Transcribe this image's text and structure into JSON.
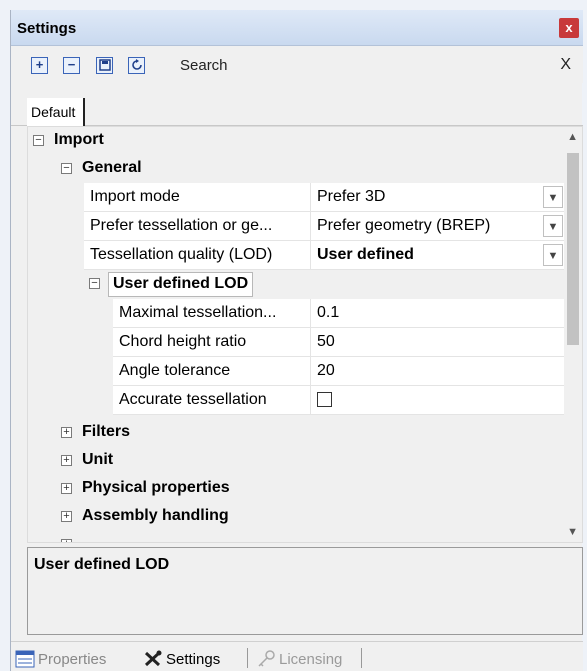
{
  "window": {
    "title": "Settings",
    "close_label": "x"
  },
  "toolbar": {
    "icons": [
      "expand-all-icon",
      "collapse-all-icon",
      "save-icon",
      "reset-icon"
    ],
    "search_label": "Search",
    "clear_label": "X"
  },
  "tabs": {
    "default_label": "Default"
  },
  "grid": {
    "import_label": "Import",
    "general_label": "General",
    "rows": [
      {
        "label": "Import mode",
        "value": "Prefer 3D",
        "dropdown": true
      },
      {
        "label": "Prefer tessellation or ge...",
        "value": "Prefer geometry (BREP)",
        "dropdown": true
      },
      {
        "label": "Tessellation quality (LOD)",
        "value": "User defined",
        "dropdown": true,
        "bold": true
      }
    ],
    "lod_label": "User defined LOD",
    "lod_rows": [
      {
        "label": "Maximal tessellation...",
        "value": "0.1"
      },
      {
        "label": "Chord height ratio",
        "value": "50"
      },
      {
        "label": "Angle tolerance",
        "value": "20"
      },
      {
        "label": "Accurate tessellation",
        "value": "",
        "checkbox": true,
        "checked": false
      }
    ],
    "categories": [
      "Filters",
      "Unit",
      "Physical properties",
      "Assembly handling"
    ]
  },
  "description": {
    "title": "User defined LOD"
  },
  "bottom_tabs": {
    "properties": "Properties",
    "settings": "Settings",
    "licensing": "Licensing"
  },
  "colors": {
    "titlebar": "#c9d9ef",
    "close": "#c8393a",
    "accent": "#3a64b8"
  }
}
